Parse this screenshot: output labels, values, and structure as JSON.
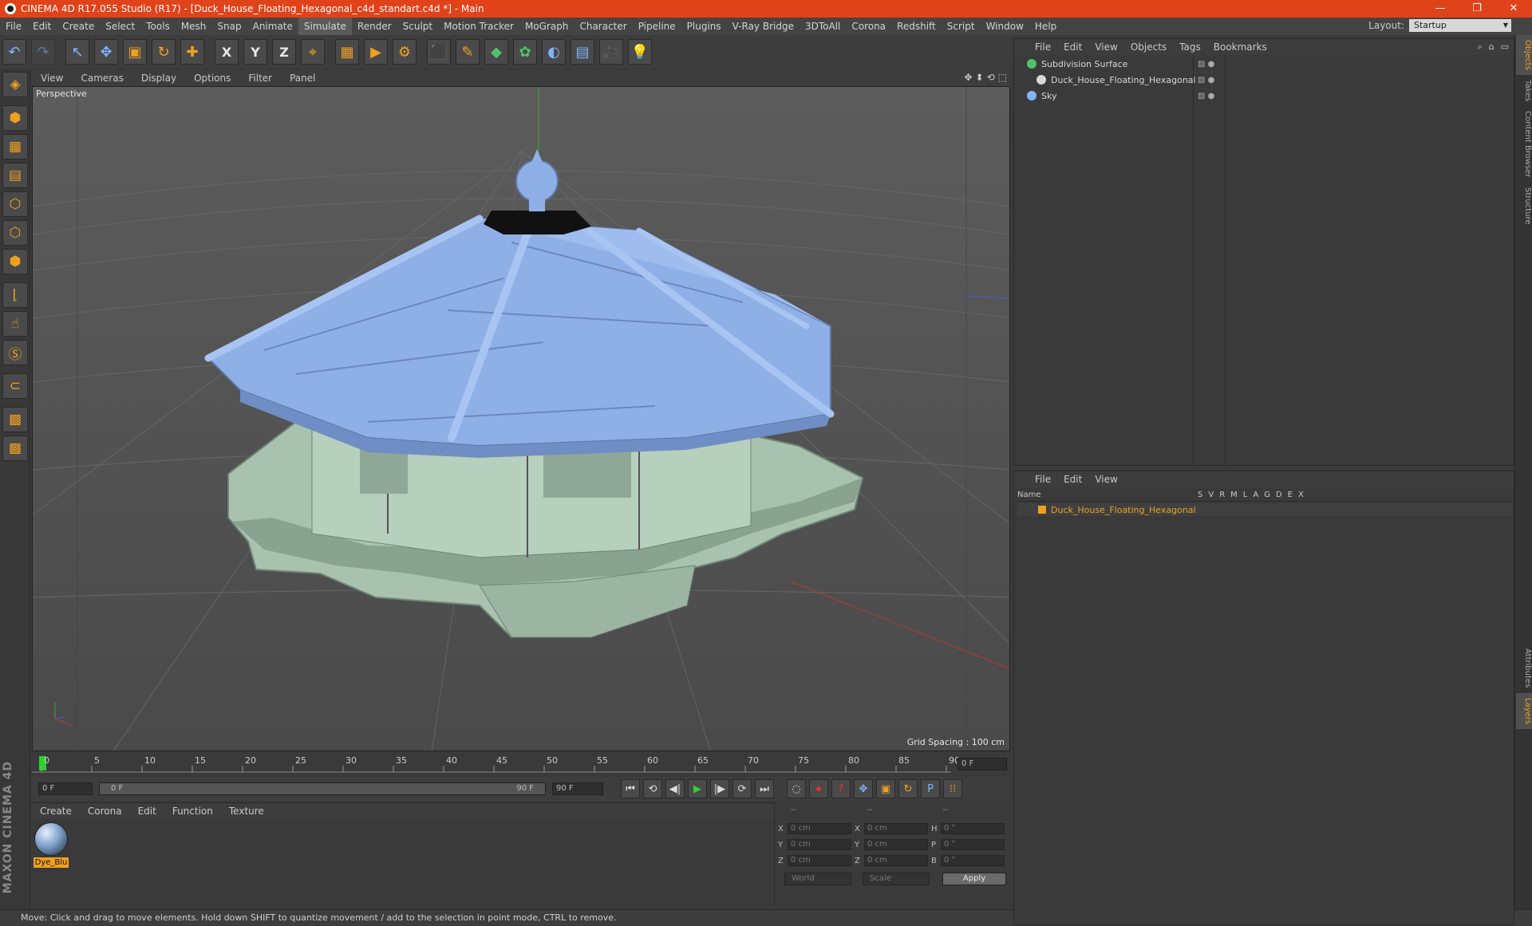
{
  "title": {
    "text": "CINEMA 4D R17.055 Studio (R17) - [Duck_House_Floating_Hexagonal_c4d_standart.c4d *] - Main",
    "minimize": "—",
    "restore": "❐",
    "close": "✕"
  },
  "menu": {
    "items": [
      "File",
      "Edit",
      "Create",
      "Select",
      "Tools",
      "Mesh",
      "Snap",
      "Animate",
      "Simulate",
      "Render",
      "Sculpt",
      "Motion Tracker",
      "MoGraph",
      "Character",
      "Pipeline",
      "Plugins",
      "V-Ray Bridge",
      "3DToAll",
      "Corona",
      "Redshift",
      "Script",
      "Window",
      "Help"
    ],
    "active": "Simulate",
    "layout_label": "Layout:",
    "layout_value": "Startup"
  },
  "toolbar": {
    "undo": "↶",
    "redo": "↷",
    "select": "↖",
    "move": "✥",
    "scale": "▣",
    "rotate": "↻",
    "live": "✚",
    "x": "X",
    "y": "Y",
    "z": "Z",
    "coord": "⌖",
    "render_region": "▦",
    "render_view": "▶",
    "render_settings": "⚙",
    "cube": "⬛",
    "pen": "✎",
    "subdiv": "◆",
    "cloner": "✿",
    "deformer": "◐",
    "floor": "▤",
    "camera": "🎥",
    "light": "💡"
  },
  "viewport": {
    "menu": [
      "View",
      "Cameras",
      "Display",
      "Options",
      "Filter",
      "Panel"
    ],
    "label": "Perspective",
    "grid_spacing": "Grid Spacing : 100 cm",
    "nav_icons": [
      "✥",
      "⬍",
      "⟲",
      "⬚"
    ]
  },
  "timeline": {
    "ticks": [
      "0",
      "5",
      "10",
      "15",
      "20",
      "25",
      "30",
      "35",
      "40",
      "45",
      "50",
      "55",
      "60",
      "65",
      "70",
      "75",
      "80",
      "85",
      "90"
    ],
    "current_frame": "0 F"
  },
  "playback": {
    "start": "0 F",
    "range_start": "0 F",
    "range_end": "90 F",
    "end": "90 F",
    "buttons": [
      "⏮",
      "⟲",
      "◀|",
      "▶",
      "|▶",
      "⟳",
      "⏭"
    ],
    "key_buttons": [
      "◌",
      "⏺",
      "?",
      "✥",
      "▣",
      "↻",
      "P",
      "⁝⁝"
    ]
  },
  "material": {
    "menu": [
      "Create",
      "Corona",
      "Edit",
      "Function",
      "Texture"
    ],
    "item_name": "Dye_Blu"
  },
  "coords": {
    "header": [
      "--",
      "--",
      "--"
    ],
    "rows": [
      {
        "l1": "X",
        "v1": "0 cm",
        "l2": "X",
        "v2": "0 cm",
        "l3": "H",
        "v3": "0 °"
      },
      {
        "l1": "Y",
        "v1": "0 cm",
        "l2": "Y",
        "v2": "0 cm",
        "l3": "P",
        "v3": "0 °"
      },
      {
        "l1": "Z",
        "v1": "0 cm",
        "l2": "Z",
        "v2": "0 cm",
        "l3": "B",
        "v3": "0 °"
      }
    ],
    "world": "World",
    "scale": "Scale",
    "apply": "Apply"
  },
  "objects": {
    "menu": [
      "File",
      "Edit",
      "View",
      "Objects",
      "Tags",
      "Bookmarks"
    ],
    "items": [
      {
        "name": "Subdivision Surface",
        "color": "#4fc36b"
      },
      {
        "name": "Duck_House_Floating_Hexagonal",
        "color": "#d8d8d8"
      },
      {
        "name": "Sky",
        "color": "#7fb4ff"
      }
    ]
  },
  "layers": {
    "menu": [
      "File",
      "Edit",
      "View"
    ],
    "header_name": "Name",
    "header_cols": [
      "S",
      "V",
      "R",
      "M",
      "L",
      "A",
      "G",
      "D",
      "E",
      "X"
    ],
    "row_name": "Duck_House_Floating_Hexagonal",
    "row_color": "#f0a020"
  },
  "side_tabs": [
    "Objects",
    "Takes",
    "Content Browser",
    "Structure",
    "Attributes",
    "Layers"
  ],
  "status": "Move: Click and drag to move elements. Hold down SHIFT to quantize movement / add to the selection in point mode, CTRL to remove.",
  "brand": "MAXON CINEMA 4D"
}
